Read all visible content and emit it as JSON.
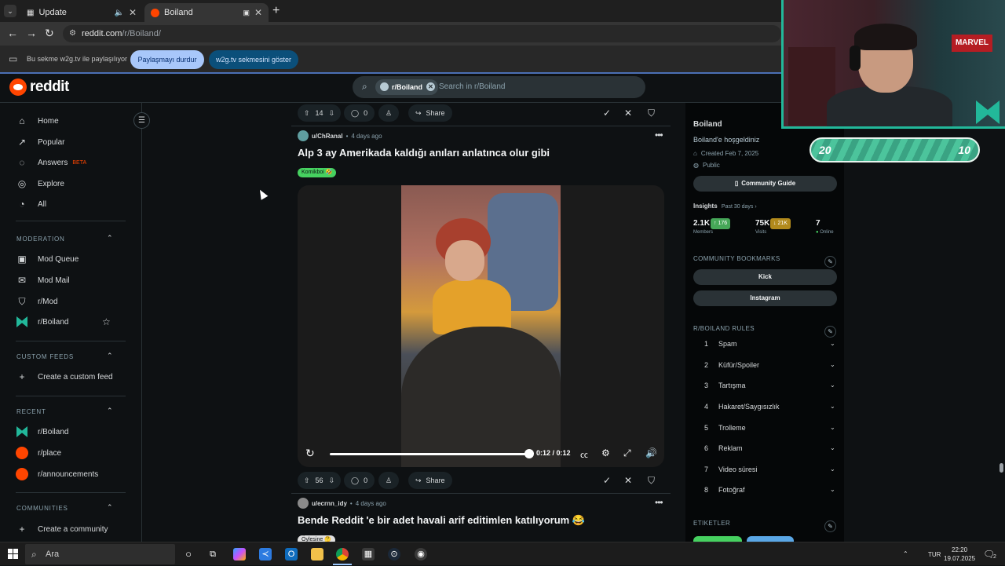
{
  "browser": {
    "tabs": [
      {
        "title": "Update",
        "active": false
      },
      {
        "title": "Boiland",
        "active": true
      }
    ],
    "new_tab": "+",
    "url_host": "reddit.com",
    "url_path": "/r/Boiland/",
    "share_message": "Bu sekme w2g.tv ile paylaşılıyor",
    "stop_sharing": "Paylaşmayı durdur",
    "show_tab": "w2g.tv sekmesini göster"
  },
  "reddit": {
    "logo_text": "reddit",
    "search_chip": "r/Boiland",
    "search_placeholder": "Search in r/Boiland"
  },
  "sidebar": {
    "nav": [
      {
        "label": "Home",
        "icon": "home-icon"
      },
      {
        "label": "Popular",
        "icon": "popular-icon"
      },
      {
        "label": "Answers",
        "icon": "answers-icon",
        "badge": "BETA"
      },
      {
        "label": "Explore",
        "icon": "explore-icon"
      },
      {
        "label": "All",
        "icon": "all-icon"
      }
    ],
    "moderation_title": "MODERATION",
    "moderation": [
      {
        "label": "Mod Queue"
      },
      {
        "label": "Mod Mail"
      },
      {
        "label": "r/Mod"
      },
      {
        "label": "r/Boiland"
      }
    ],
    "custom_feeds_title": "CUSTOM FEEDS",
    "create_custom_feed": "Create a custom feed",
    "recent_title": "RECENT",
    "recent": [
      {
        "label": "r/Boiland",
        "color": "#22b89a"
      },
      {
        "label": "r/place",
        "color": "#ff4500"
      },
      {
        "label": "r/announcements",
        "color": "#ff4500"
      }
    ],
    "communities_title": "COMMUNITIES",
    "create_community": "Create a community"
  },
  "posts": [
    {
      "votes": "14",
      "comments": "0",
      "share": "Share"
    },
    {
      "author": "u/ChRanal",
      "time": "4 days ago",
      "title": "Alp 3 ay Amerikada kaldığı anıları anlatınca olur gibi",
      "flair": "Komikboi 🤣",
      "flair_color": "#46d160",
      "video_time": "0:12 / 0:12",
      "progress": 1.0,
      "votes": "56",
      "comments": "0",
      "share": "Share"
    },
    {
      "author": "u/ecrnn_idy",
      "time": "4 days ago",
      "title": "Bende Reddit 'e bir adet havali arif editimlen katılıyorum 😂",
      "flair": "Öylesine 🤔"
    }
  ],
  "community": {
    "name": "Boiland",
    "welcome": "Boiland'e hoşgeldiniz",
    "created": "Created Feb 7, 2025",
    "visibility": "Public",
    "guide_button": "Community Guide",
    "insights_label": "Insights",
    "insights_period": "Past 30 days ›",
    "members": "2.1K",
    "members_delta": "↑ 176",
    "members_label": "Members",
    "visits": "75K",
    "visits_delta": "↓ 21K",
    "visits_label": "Visits",
    "online": "7",
    "online_label": "Online",
    "bookmarks_title": "COMMUNITY BOOKMARKS",
    "bookmarks": [
      "Kick",
      "Instagram"
    ],
    "rules_title": "R/BOILAND RULES",
    "rules": [
      {
        "n": "1",
        "label": "Spam"
      },
      {
        "n": "2",
        "label": "Küfür/Spoiler"
      },
      {
        "n": "3",
        "label": "Tartışma"
      },
      {
        "n": "4",
        "label": "Hakaret/Saygısızlık"
      },
      {
        "n": "5",
        "label": "Trolleme"
      },
      {
        "n": "6",
        "label": "Reklam"
      },
      {
        "n": "7",
        "label": "Video süresi"
      },
      {
        "n": "8",
        "label": "Fotoğraf"
      }
    ],
    "tags_title": "ETIKETLER"
  },
  "overlay": {
    "score_left": "20",
    "score_right": "10",
    "poster_text": "MARVEL"
  },
  "taskbar": {
    "search_label": "Ara",
    "lang": "TUR",
    "time": "22:20",
    "date": "19.07.2025",
    "notif_count": "2"
  }
}
